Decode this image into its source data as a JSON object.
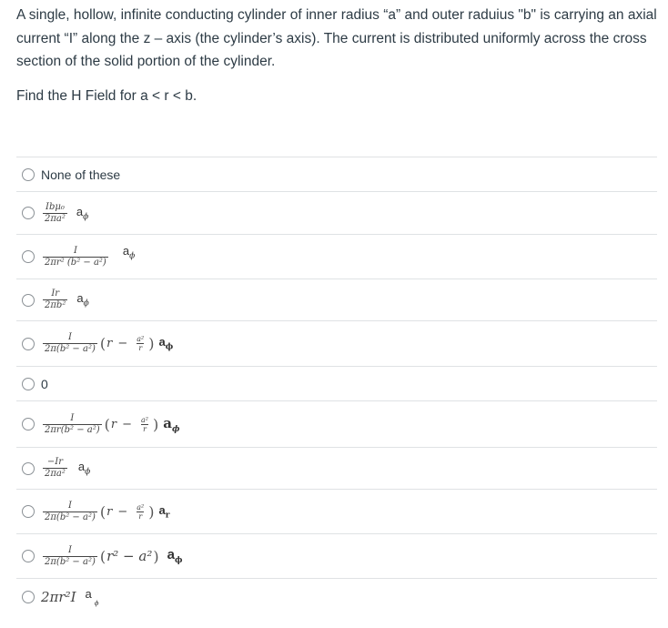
{
  "question": {
    "text": "A single, hollow, infinite conducting cylinder of inner radius “a” and outer raduius \"b\" is carrying an axial current “I” along the z – axis (the cylinder’s axis). The current is distributed uniformly across the cross section of the solid portion of the cylinder.",
    "prompt": "Find the H Field for  a < r < b."
  },
  "answers": [
    {
      "id": "none",
      "label": "None of these"
    },
    {
      "id": "opt2",
      "num": "Ibμ₀",
      "den": "2πa²",
      "vec": "a",
      "sub": "ϕ"
    },
    {
      "id": "opt3",
      "num": "I",
      "den": "2πr² (b² − a²)",
      "vec": "a",
      "sub": "ϕ"
    },
    {
      "id": "opt4",
      "num": "Ir",
      "den": "2πb²",
      "vec": "a",
      "sub": "ϕ"
    },
    {
      "id": "opt5",
      "num": "I",
      "den": "2π(b² − a²)",
      "inner_var": "r",
      "inner_op": "−",
      "inner_num": "a²",
      "inner_den": "r",
      "vec": "a",
      "sub": "ϕ"
    },
    {
      "id": "zero",
      "label": "0"
    },
    {
      "id": "opt7",
      "num": "I",
      "den": "2πr(b² − a²)",
      "inner_var": "r",
      "inner_op": "−",
      "inner_num": "a²",
      "inner_den": "r",
      "vec": "a",
      "sub": "ϕ"
    },
    {
      "id": "opt8",
      "num": "−Ir",
      "den": "2πa²",
      "vec": "a",
      "sub": "ϕ"
    },
    {
      "id": "opt9",
      "num": "I",
      "den": "2π(b² − a²)",
      "inner_var": "r",
      "inner_op": "−",
      "inner_num": "a²",
      "inner_den": "r",
      "vec": "a",
      "sub": "r"
    },
    {
      "id": "opt10",
      "num": "I",
      "den": "2π(b² − a²)",
      "inner_expr": "r² − a²",
      "vec": "a",
      "sub": "ϕ"
    },
    {
      "id": "opt11",
      "expr": "2πr²I",
      "vec": "a",
      "sub": "ϕ"
    }
  ]
}
